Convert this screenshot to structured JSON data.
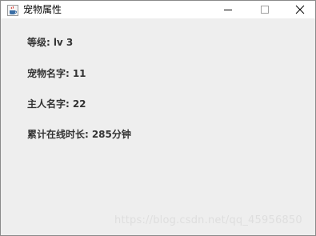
{
  "window": {
    "title": "宠物属性",
    "app_icon": "java-cup-icon"
  },
  "controls": {
    "minimize_icon": "minimize-icon",
    "maximize_icon": "maximize-icon",
    "close_icon": "close-icon"
  },
  "fields": [
    {
      "label": "等级:",
      "value": "lv 3"
    },
    {
      "label": "宠物名字:",
      "value": "11"
    },
    {
      "label": "主人名字:",
      "value": "22"
    },
    {
      "label": "累计在线时长:",
      "value": "285分钟"
    }
  ],
  "watermark": "https://blog.csdn.net/qq_45956850"
}
